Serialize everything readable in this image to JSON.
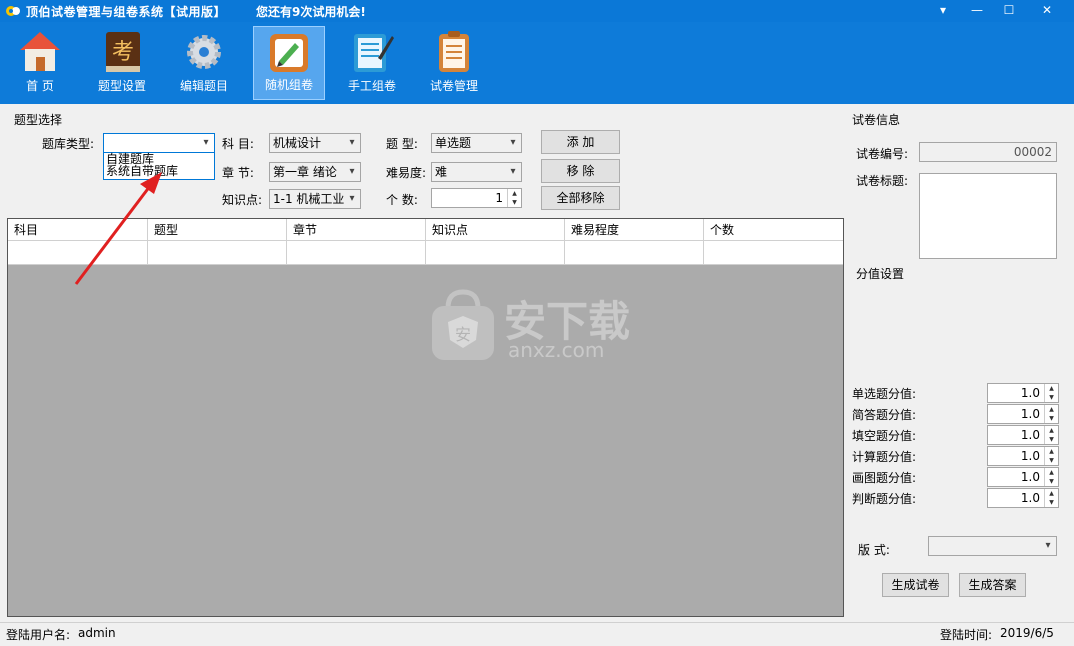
{
  "window": {
    "title": "顶伯试卷管理与组卷系统【试用版】",
    "trial_notice": "您还有9次试用机会!",
    "controls": [
      "▾",
      "—",
      "☐",
      "✕"
    ]
  },
  "toolbar": {
    "items": [
      {
        "label": "首  页",
        "icon": "home-icon"
      },
      {
        "label": "题型设置",
        "icon": "exam-book-icon"
      },
      {
        "label": "编辑题目",
        "icon": "gear-icon"
      },
      {
        "label": "随机组卷",
        "icon": "draw-board-icon"
      },
      {
        "label": "手工组卷",
        "icon": "notebook-pen-icon"
      },
      {
        "label": "试卷管理",
        "icon": "clipboard-icon"
      }
    ],
    "active_index": 3
  },
  "selection": {
    "group_title": "题型选择",
    "bank_type_label": "题库类型:",
    "bank_type_value": "",
    "bank_type_options": [
      "自建题库",
      "系统自带题库"
    ],
    "subject_label": "科  目:",
    "subject_value": "机械设计",
    "chapter_label": "章  节:",
    "chapter_value": "第一章 绪论",
    "knowledge_label": "知识点:",
    "knowledge_value": "1-1 机械工业",
    "qtype_label": "题  型:",
    "qtype_value": "单选题",
    "difficulty_label": "难易度:",
    "difficulty_value": "难",
    "count_label": "个  数:",
    "count_value": "1",
    "add_button": "添    加",
    "remove_button": "移    除",
    "remove_all_button": "全部移除"
  },
  "table": {
    "columns": [
      "科目",
      "题型",
      "章节",
      "知识点",
      "难易程度",
      "个数"
    ],
    "rows": [
      [
        "",
        "",
        "",
        "",
        "",
        ""
      ]
    ]
  },
  "watermark": {
    "text": "安下载",
    "sub": "anxz.com"
  },
  "paper_info": {
    "group_title": "试卷信息",
    "number_label": "试卷编号:",
    "number_value": "00002",
    "title_label": "试卷标题:",
    "title_value": ""
  },
  "scores": {
    "group_title": "分值设置",
    "items": [
      {
        "label": "单选题分值:",
        "value": "1.0"
      },
      {
        "label": "简答题分值:",
        "value": "1.0"
      },
      {
        "label": "填空题分值:",
        "value": "1.0"
      },
      {
        "label": "计算题分值:",
        "value": "1.0"
      },
      {
        "label": "画图题分值:",
        "value": "1.0"
      },
      {
        "label": "判断题分值:",
        "value": "1.0"
      }
    ]
  },
  "format": {
    "label": "版      式:",
    "value": "",
    "generate_paper": "生成试卷",
    "generate_answer": "生成答案"
  },
  "status": {
    "user_label": "登陆用户名:",
    "user_value": "admin",
    "time_label": "登陆时间:",
    "time_value": "2019/6/5"
  },
  "colors": {
    "titlebar": "#0b78d7",
    "toolbar": "#0e7bd9",
    "grid_bg": "#ababab",
    "arrow": "#e02020"
  }
}
